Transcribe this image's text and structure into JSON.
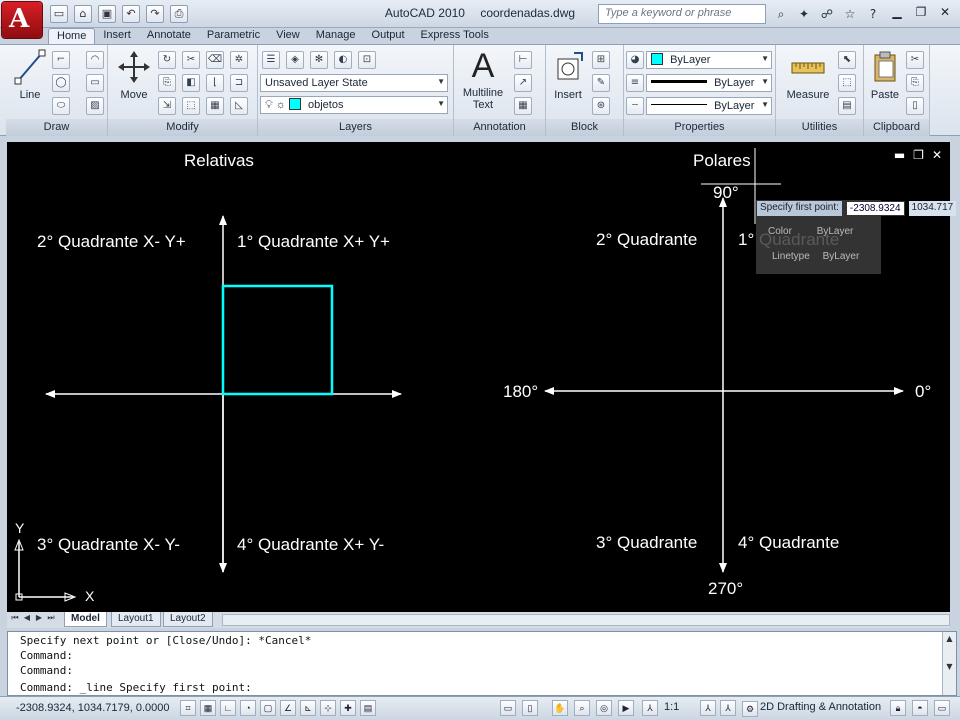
{
  "window": {
    "app_name": "AutoCAD 2010",
    "file_name": "coordenadas.dwg",
    "search_placeholder": "Type a keyword or phrase"
  },
  "ribbon_tabs": [
    "Home",
    "Insert",
    "Annotate",
    "Parametric",
    "View",
    "Manage",
    "Output",
    "Express Tools"
  ],
  "ribbon": {
    "draw": {
      "panel_label": "Draw",
      "line_label": "Line"
    },
    "modify": {
      "panel_label": "Modify",
      "move_label": "Move"
    },
    "layers": {
      "panel_label": "Layers",
      "layer_state": "Unsaved Layer State",
      "current_layer": "objetos"
    },
    "annotation": {
      "panel_label": "Annotation",
      "text_label_1": "Multiline",
      "text_label_2": "Text"
    },
    "block": {
      "panel_label": "Block",
      "insert_label": "Insert"
    },
    "properties": {
      "panel_label": "Properties",
      "color": "ByLayer",
      "lineweight": "ByLayer",
      "linetype": "ByLayer"
    },
    "utilities": {
      "panel_label": "Utilities",
      "measure_label": "Measure"
    },
    "clipboard": {
      "panel_label": "Clipboard",
      "paste_label": "Paste"
    }
  },
  "drawing": {
    "left_title": "Relativas",
    "right_title": "Polares",
    "q2_rel": "2° Quadrante X- Y+",
    "q1_rel": "1° Quadrante X+ Y+",
    "q3_rel": "3° Quadrante X- Y-",
    "q4_rel": "4° Quadrante X+ Y-",
    "q2_pol": "2° Quadrante",
    "q1_pol": "1° Quadrante",
    "q3_pol": "3° Quadrante",
    "q4_pol": "4° Quadrante",
    "angle_90": "90°",
    "angle_180": "180°",
    "angle_0": "0°",
    "angle_270": "270°",
    "ucs_x": "X",
    "ucs_y": "Y"
  },
  "dynamic_input": {
    "prompt": "Specify first point:",
    "x_value": "-2308.9324",
    "y_value": "1034.717"
  },
  "tooltip": {
    "color_label": "Color",
    "color_value": "ByLayer",
    "linetype_label": "Linetype",
    "linetype_value": "ByLayer"
  },
  "layout_tabs": [
    "Model",
    "Layout1",
    "Layout2"
  ],
  "command_lines": [
    "Specify next point or [Close/Undo]: *Cancel*",
    "Command:",
    "Command:",
    "Command: _line Specify first point:"
  ],
  "status": {
    "coordinates": "-2308.9324, 1034.7179, 0.0000",
    "annotation_scale": "1:1",
    "workspace": "2D Drafting & Annotation"
  },
  "colors": {
    "accent_cyan": "#00ffff",
    "canvas_bg": "#000000",
    "autocad_red": "#c0161c"
  }
}
